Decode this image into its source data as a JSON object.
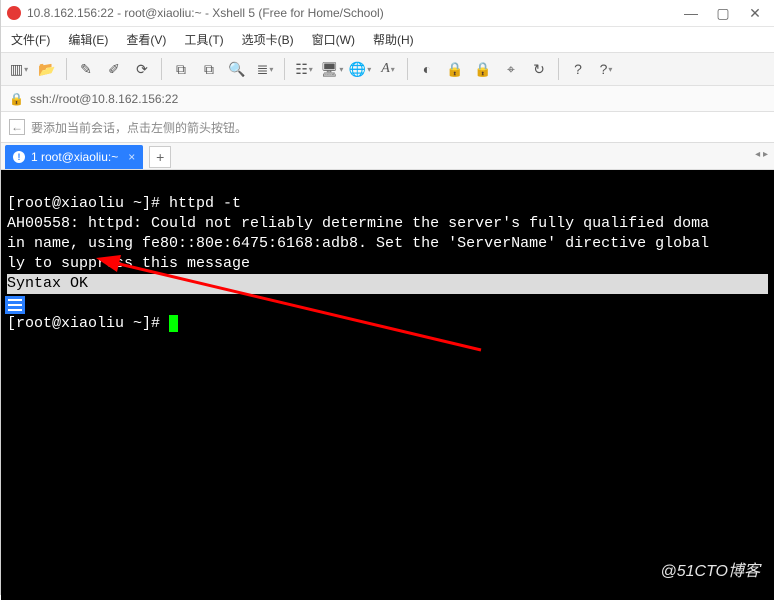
{
  "window": {
    "title": "10.8.162.156:22 - root@xiaoliu:~ - Xshell 5 (Free for Home/School)"
  },
  "menu": {
    "file": "文件(F)",
    "edit": "编辑(E)",
    "view": "查看(V)",
    "tools": "工具(T)",
    "tabs": "选项卡(B)",
    "window": "窗口(W)",
    "help": "帮助(H)"
  },
  "address": {
    "protocol_path": "ssh://root@10.8.162.156:22"
  },
  "hint": {
    "text": "要添加当前会话，点击左侧的箭头按钮。"
  },
  "tab": {
    "label": "1 root@xiaoliu:~",
    "close": "×",
    "plus": "+",
    "corner": "◂ ▸"
  },
  "icons": {
    "new": "▥",
    "open": "📂",
    "wand": "✎",
    "brush": "✐",
    "reconnect": "⟳",
    "copy1": "⧉",
    "copy2": "⧉",
    "search": "🔍",
    "align": "≣",
    "servers": "☷",
    "monitor": "🖥",
    "globe": "🌐",
    "font": "A",
    "circle": "◐",
    "lock": "🔒",
    "lock2": "🔒",
    "target": "⌖",
    "refresh": "↻",
    "q": "?",
    "q2": "?"
  },
  "terminal": {
    "line1": "[root@xiaoliu ~]# httpd -t",
    "line2": "AH00558: httpd: Could not reliably determine the server's fully qualified doma",
    "line3": "in name, using fe80::80e:6475:6168:adb8. Set the 'ServerName' directive global",
    "line4": "ly to suppress this message",
    "line5": "Syntax OK",
    "line6": "[root@xiaoliu ~]# "
  },
  "watermark": "@51CTO博客"
}
